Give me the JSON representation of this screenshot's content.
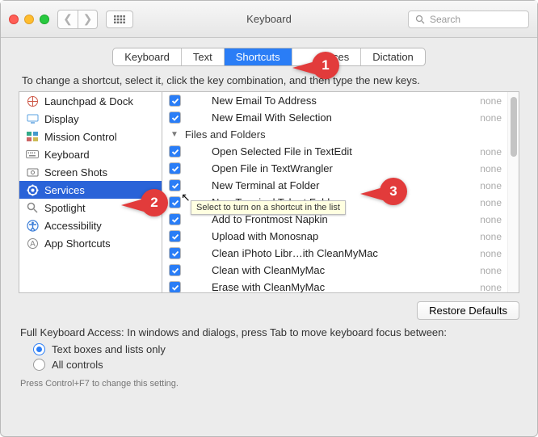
{
  "window": {
    "title": "Keyboard"
  },
  "search": {
    "placeholder": "Search"
  },
  "tabs": [
    {
      "label": "Keyboard"
    },
    {
      "label": "Text"
    },
    {
      "label": "Shortcuts",
      "selected": true
    },
    {
      "label": "rces"
    },
    {
      "label": "Dictation"
    }
  ],
  "instruction": "To change a shortcut, select it, click the key combination, and then type the new keys.",
  "categories": [
    {
      "label": "Launchpad & Dock",
      "icon": "launchpad"
    },
    {
      "label": "Display",
      "icon": "display"
    },
    {
      "label": "Mission Control",
      "icon": "mission"
    },
    {
      "label": "Keyboard",
      "icon": "keyboard"
    },
    {
      "label": "Screen Shots",
      "icon": "screenshot"
    },
    {
      "label": "Services",
      "icon": "services",
      "selected": true
    },
    {
      "label": "Spotlight",
      "icon": "spotlight"
    },
    {
      "label": "Accessibility",
      "icon": "accessibility"
    },
    {
      "label": "App Shortcuts",
      "icon": "apps"
    }
  ],
  "shortcuts": [
    {
      "label": "New Email To Address",
      "checked": true,
      "indent": true,
      "value": "none"
    },
    {
      "label": "New Email With Selection",
      "checked": true,
      "indent": true,
      "value": "none"
    },
    {
      "label": "Files and Folders",
      "group": true
    },
    {
      "label": "Open Selected File in TextEdit",
      "checked": true,
      "indent": true,
      "value": "none"
    },
    {
      "label": "Open File in TextWrangler",
      "checked": true,
      "indent": true,
      "value": "none"
    },
    {
      "label": "New Terminal at Folder",
      "checked": true,
      "indent": true,
      "value": "none"
    },
    {
      "label": "New Terminal Tab at Folder",
      "checked": true,
      "indent": true,
      "value": "none"
    },
    {
      "label": "Add to Frontmost Napkin",
      "checked": true,
      "indent": true,
      "value": "none"
    },
    {
      "label": "Upload with Monosnap",
      "checked": true,
      "indent": true,
      "value": "none"
    },
    {
      "label": "Clean iPhoto Libr…ith CleanMyMac",
      "checked": true,
      "indent": true,
      "value": "none"
    },
    {
      "label": "Clean with CleanMyMac",
      "checked": true,
      "indent": true,
      "value": "none"
    },
    {
      "label": "Erase with CleanMyMac",
      "checked": true,
      "indent": true,
      "value": "none"
    }
  ],
  "tooltip": "Select to turn on a shortcut in the list",
  "restore_defaults": "Restore Defaults",
  "fka": {
    "title": "Full Keyboard Access: In windows and dialogs, press Tab to move keyboard focus between:",
    "opt1": "Text boxes and lists only",
    "opt2": "All controls",
    "hint": "Press Control+F7 to change this setting."
  },
  "callouts": {
    "c1": "1",
    "c2": "2",
    "c3": "3"
  }
}
